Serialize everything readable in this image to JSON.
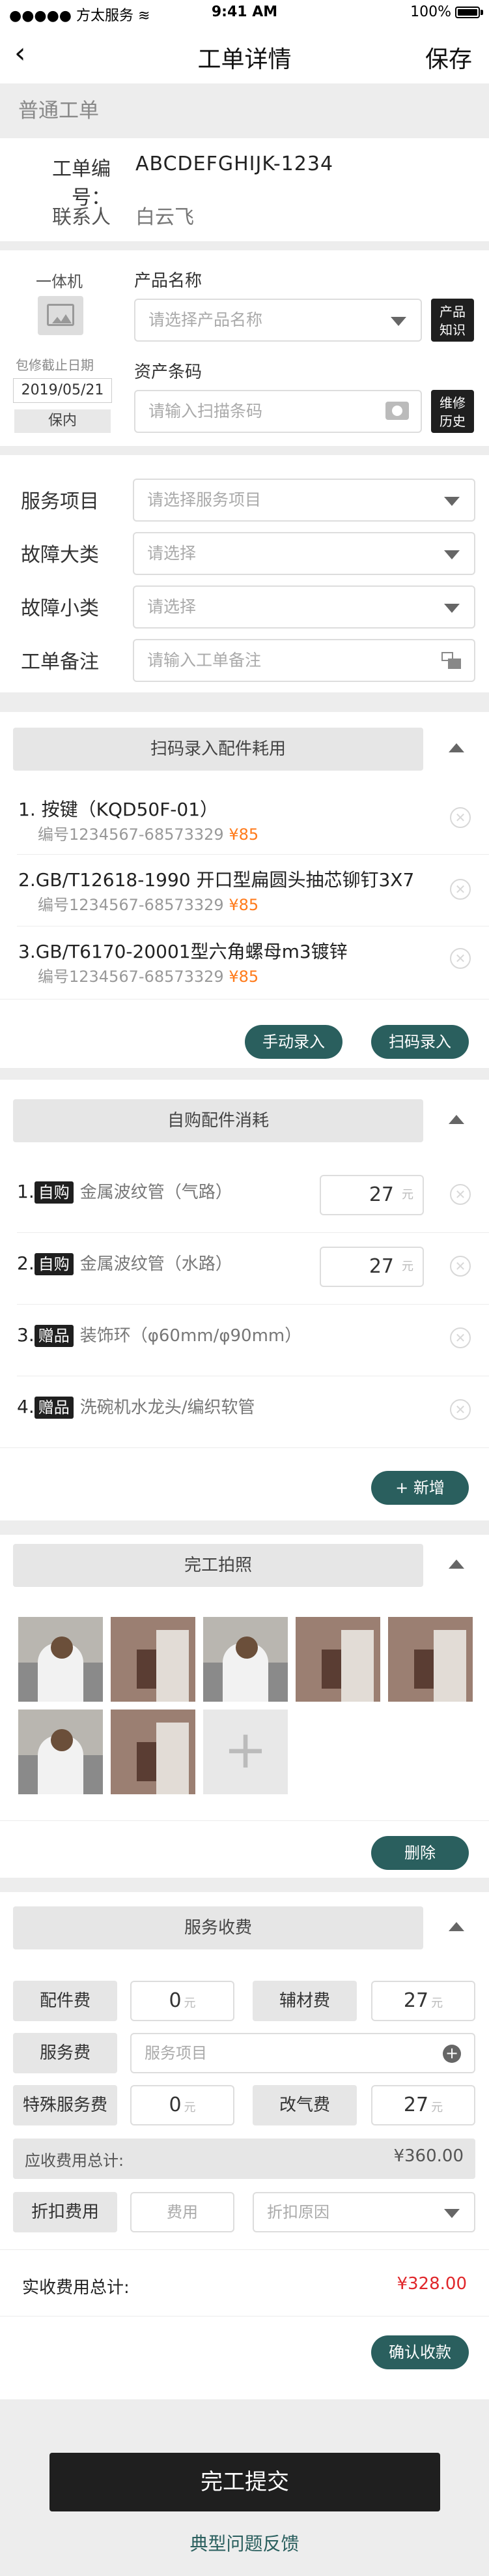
{
  "status": {
    "carrier": "方太服务",
    "time": "9:41 AM",
    "battery": "100%"
  },
  "nav": {
    "title": "工单详情",
    "save": "保存"
  },
  "section_common": "普通工单",
  "order": {
    "no_label": "工单编号：",
    "no_value": "ABCDEFGHIJK-1234",
    "contact_label": "联系人",
    "contact_value": "白云飞"
  },
  "product": {
    "type": "一体机",
    "warranty_label": "包修截止日期",
    "warranty_date": "2019/05/21",
    "warranty_status": "保内",
    "name_label": "产品名称",
    "name_placeholder": "请选择产品名称",
    "knowledge_btn": "产品\n知识",
    "asset_label": "资产条码",
    "asset_placeholder": "请输入扫描条码",
    "history_btn": "维修\n历史"
  },
  "service": {
    "item_label": "服务项目",
    "item_placeholder": "请选择服务项目",
    "fault_major_label": "故障大类",
    "fault_major_placeholder": "请选择",
    "fault_minor_label": "故障小类",
    "fault_minor_placeholder": "请选择",
    "note_label": "工单备注",
    "note_placeholder": "请输入工单备注"
  },
  "scan_parts": {
    "title": "扫码录入配件耗用",
    "items": [
      {
        "name": "1. 按键（KQD50F-01）",
        "code": "编号1234567-68573329",
        "price": "¥85"
      },
      {
        "name": "2.GB/T12618-1990 开口型扁圆头抽芯铆钉3X7",
        "code": "编号1234567-68573329",
        "price": "¥85"
      },
      {
        "name": "3.GB/T6170-20001型六角螺母m3镀锌",
        "code": "编号1234567-68573329",
        "price": "¥85"
      }
    ],
    "manual_btn": "手动录入",
    "scan_btn": "扫码录入"
  },
  "own_parts": {
    "title": "自购配件消耗",
    "items": [
      {
        "index": "1.",
        "tag": "自购",
        "name": "金属波纹管（气路）",
        "qty": "27",
        "unit": "元"
      },
      {
        "index": "2.",
        "tag": "自购",
        "name": "金属波纹管（水路）",
        "qty": "27",
        "unit": "元"
      },
      {
        "index": "3.",
        "tag": "赠品",
        "name": "装饰环（φ60mm/φ90mm）"
      },
      {
        "index": "4.",
        "tag": "赠品",
        "name": "洗碗机水龙头/编织软管"
      }
    ],
    "add_btn": "+ 新增"
  },
  "photos": {
    "title": "完工拍照",
    "delete_btn": "删除",
    "add_icon": "+"
  },
  "fees": {
    "title": "服务收费",
    "parts_label": "配件费",
    "parts_value": "0",
    "unit": "元",
    "aux_label": "辅材费",
    "aux_value": "27",
    "service_label": "服务费",
    "service_placeholder": "服务项目",
    "special_label": "特殊服务费",
    "special_value": "0",
    "gas_label": "改气费",
    "gas_value": "27",
    "total_label": "应收费用总计:",
    "total_value": "¥360.00",
    "discount_label": "折扣费用",
    "discount_placeholder": "费用",
    "reason_placeholder": "折扣原因",
    "actual_label": "实收费用总计:",
    "actual_value": "¥328.00",
    "confirm_btn": "确认收款"
  },
  "footer": {
    "submit": "完工提交",
    "feedback": "典型问题反馈"
  },
  "colors": {
    "accent": "#2a5f5e",
    "orange": "#ff7a1a",
    "red": "#e0262a",
    "dark": "#1f1f1f"
  }
}
